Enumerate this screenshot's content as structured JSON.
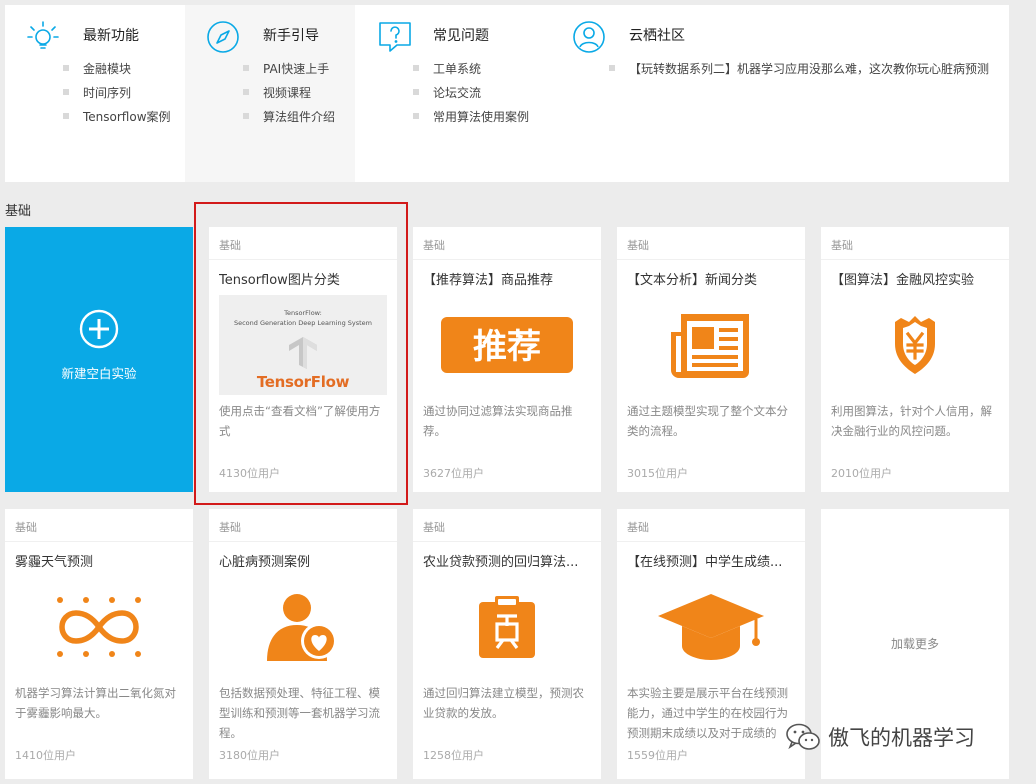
{
  "top": {
    "sections": [
      {
        "title": "最新功能",
        "items": [
          "金融模块",
          "时间序列",
          "Tensorflow案例"
        ]
      },
      {
        "title": "新手引导",
        "items": [
          "PAI快速上手",
          "视频课程",
          "算法组件介绍"
        ]
      },
      {
        "title": "常见问题",
        "items": [
          "工单系统",
          "论坛交流",
          "常用算法使用案例"
        ]
      },
      {
        "title": "云栖社区",
        "items": [
          "【玩转数据系列二】机器学习应用没那么难，这次教你玩心脏病预测"
        ]
      }
    ]
  },
  "section_label": "基础",
  "new_card": {
    "label": "新建空白实验"
  },
  "tf_image": {
    "line1": "TensorFlow:",
    "line2": "Second Generation Deep Learning System",
    "word": "TensorFlow"
  },
  "art_text": {
    "tuijian": "推荐"
  },
  "cards": [
    {
      "tag": "基础",
      "title": "Tensorflow图片分类",
      "desc": "使用点击“查看文档”了解使用方式",
      "users": "4130位用户"
    },
    {
      "tag": "基础",
      "title": "【推荐算法】商品推荐",
      "desc": "通过协同过滤算法实现商品推荐。",
      "users": "3627位用户"
    },
    {
      "tag": "基础",
      "title": "【文本分析】新闻分类",
      "desc": "通过主题模型实现了整个文本分类的流程。",
      "users": "3015位用户"
    },
    {
      "tag": "基础",
      "title": "【图算法】金融风控实验",
      "desc": "利用图算法，针对个人信用，解决金融行业的风控问题。",
      "users": "2010位用户"
    },
    {
      "tag": "基础",
      "title": "雾霾天气预测",
      "desc": "机器学习算法计算出二氧化氮对于雾霾影响最大。",
      "users": "1410位用户"
    },
    {
      "tag": "基础",
      "title": "心脏病预测案例",
      "desc": "包括数据预处理、特征工程、模型训练和预测等一套机器学习流程。",
      "users": "3180位用户"
    },
    {
      "tag": "基础",
      "title": "农业贷款预测的回归算法...",
      "desc": "通过回归算法建立模型，预测农业贷款的发放。",
      "users": "1258位用户"
    },
    {
      "tag": "基础",
      "title": "【在线预测】中学生成绩...",
      "desc": "本实验主要是展示平台在线预测能力，通过中学生的在校园行为预测期末成绩以及对于成绩的",
      "users": "1559位用户"
    }
  ],
  "more": {
    "label": "加载更多"
  },
  "watermark": {
    "text": "傲飞的机器学习"
  },
  "colors": {
    "accent_blue": "#0aa9e6",
    "icon_orange": "#f08519",
    "highlight_red": "#d21a1a"
  }
}
